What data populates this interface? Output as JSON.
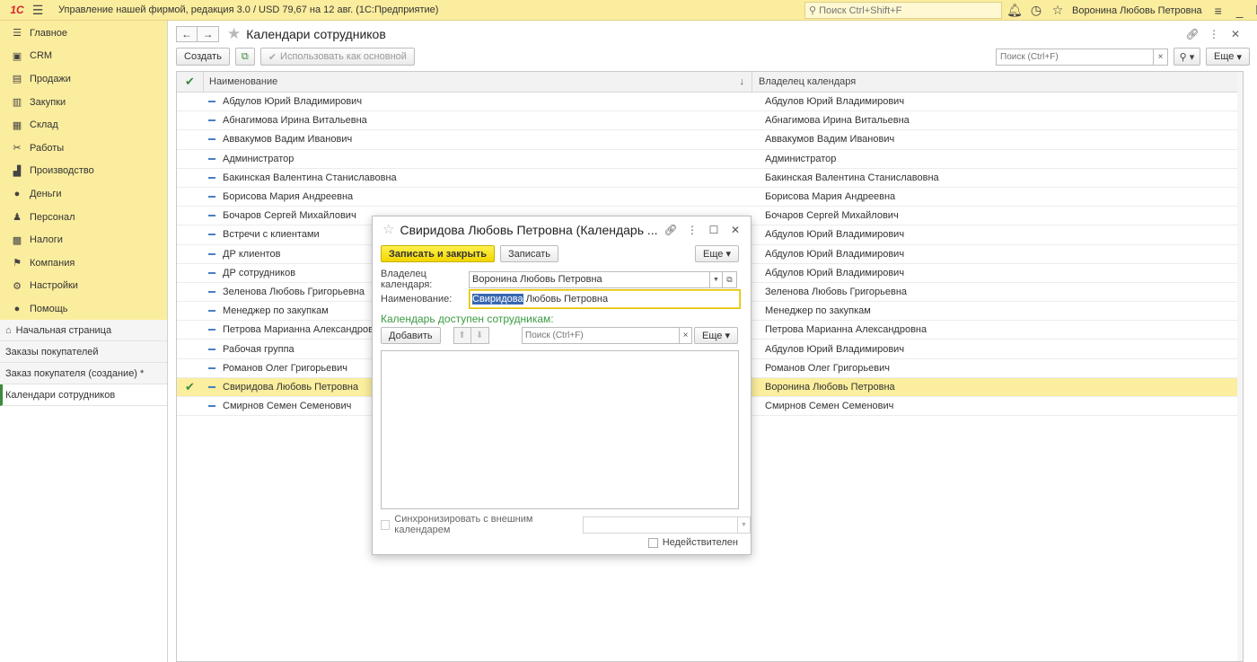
{
  "app": {
    "title": "Управление нашей фирмой, редакция 3.0 / USD 79,67 на 12 авг.  (1С:Предприятие)",
    "logo_text": "1С",
    "search_placeholder": "Поиск Ctrl+Shift+F",
    "user": "Воронина Любовь Петровна",
    "icons": [
      "menu-icon",
      "search-icon",
      "bell-icon",
      "history-icon",
      "star-icon",
      "settings-icon",
      "minimize-icon",
      "restore-icon",
      "close-icon"
    ]
  },
  "sidebar": {
    "sections": [
      {
        "label": "Главное",
        "icon": "☰"
      },
      {
        "label": "CRM",
        "icon": "▣"
      },
      {
        "label": "Продажи",
        "icon": "▤"
      },
      {
        "label": "Закупки",
        "icon": "▥"
      },
      {
        "label": "Склад",
        "icon": "▦"
      },
      {
        "label": "Работы",
        "icon": "✂"
      },
      {
        "label": "Производство",
        "icon": "▟"
      },
      {
        "label": "Деньги",
        "icon": "●"
      },
      {
        "label": "Персонал",
        "icon": "♟"
      },
      {
        "label": "Налоги",
        "icon": "▩"
      },
      {
        "label": "Компания",
        "icon": "⚑"
      },
      {
        "label": "Настройки",
        "icon": "⚙"
      },
      {
        "label": "Помощь",
        "icon": "●"
      }
    ],
    "open_windows": [
      {
        "label": "Начальная страница"
      },
      {
        "label": "Заказы покупателей"
      },
      {
        "label": "Заказ покупателя (создание) *"
      },
      {
        "label": "Календари сотрудников"
      }
    ]
  },
  "page": {
    "title": "Календари сотрудников",
    "create_label": "Создать",
    "use_default_label": "Использовать как основной",
    "search_placeholder": "Поиск (Ctrl+F)",
    "search_clear": "×",
    "more_label": "Еще",
    "columns": {
      "name": "Наименование",
      "owner": "Владелец календаря",
      "sort": "↓"
    },
    "rows": [
      {
        "name": "Абдулов Юрий Владимирович",
        "owner": "Абдулов Юрий Владимирович",
        "selected": false
      },
      {
        "name": "Абнагимова Ирина Витальевна",
        "owner": "Абнагимова Ирина Витальевна",
        "selected": false
      },
      {
        "name": "Аввакумов Вадим Иванович",
        "owner": "Аввакумов Вадим Иванович",
        "selected": false
      },
      {
        "name": "Администратор",
        "owner": "Администратор",
        "selected": false
      },
      {
        "name": "Бакинская Валентина Станиславовна",
        "owner": "Бакинская Валентина Станиславовна",
        "selected": false
      },
      {
        "name": "Борисова Мария Андреевна",
        "owner": "Борисова Мария Андреевна",
        "selected": false
      },
      {
        "name": "Бочаров Сергей Михайлович",
        "owner": "Бочаров Сергей Михайлович",
        "selected": false
      },
      {
        "name": "Встречи с клиентами",
        "owner": "Абдулов Юрий Владимирович",
        "selected": false
      },
      {
        "name": "ДР клиентов",
        "owner": "Абдулов Юрий Владимирович",
        "selected": false
      },
      {
        "name": "ДР сотрудников",
        "owner": "Абдулов Юрий Владимирович",
        "selected": false
      },
      {
        "name": "Зеленова Любовь Григорьевна",
        "owner": "Зеленова Любовь Григорьевна",
        "selected": false
      },
      {
        "name": "Менеджер по закупкам",
        "owner": "Менеджер по закупкам",
        "selected": false
      },
      {
        "name": "Петрова Марианна Александровна",
        "owner": "Петрова Марианна Александровна",
        "selected": false
      },
      {
        "name": "Рабочая группа",
        "owner": "Абдулов Юрий Владимирович",
        "selected": false
      },
      {
        "name": "Романов Олег Григорьевич",
        "owner": "Романов Олег Григорьевич",
        "selected": false
      },
      {
        "name": "Свиридова Любовь Петровна",
        "owner": "Воронина Любовь Петровна",
        "selected": true
      },
      {
        "name": "Смирнов Семен Семенович",
        "owner": "Смирнов Семен Семенович",
        "selected": false
      }
    ]
  },
  "dialog": {
    "title": "Свиридова Любовь Петровна (Календарь ...",
    "save_close_label": "Записать и закрыть",
    "save_label": "Записать",
    "more_label": "Еще",
    "owner_label": "Владелец календаря:",
    "owner_value": "Воронина Любовь Петровна",
    "name_label": "Наименование:",
    "name_selected_part": "Свиридова",
    "name_rest": " Любовь Петровна",
    "access_title": "Календарь доступен сотрудникам:",
    "add_label": "Добавить",
    "search_placeholder": "Поиск (Ctrl+F)",
    "search_clear": "×",
    "sync_label": "Синхронизировать с внешним календарем",
    "invalid_label": "Недействителен"
  }
}
